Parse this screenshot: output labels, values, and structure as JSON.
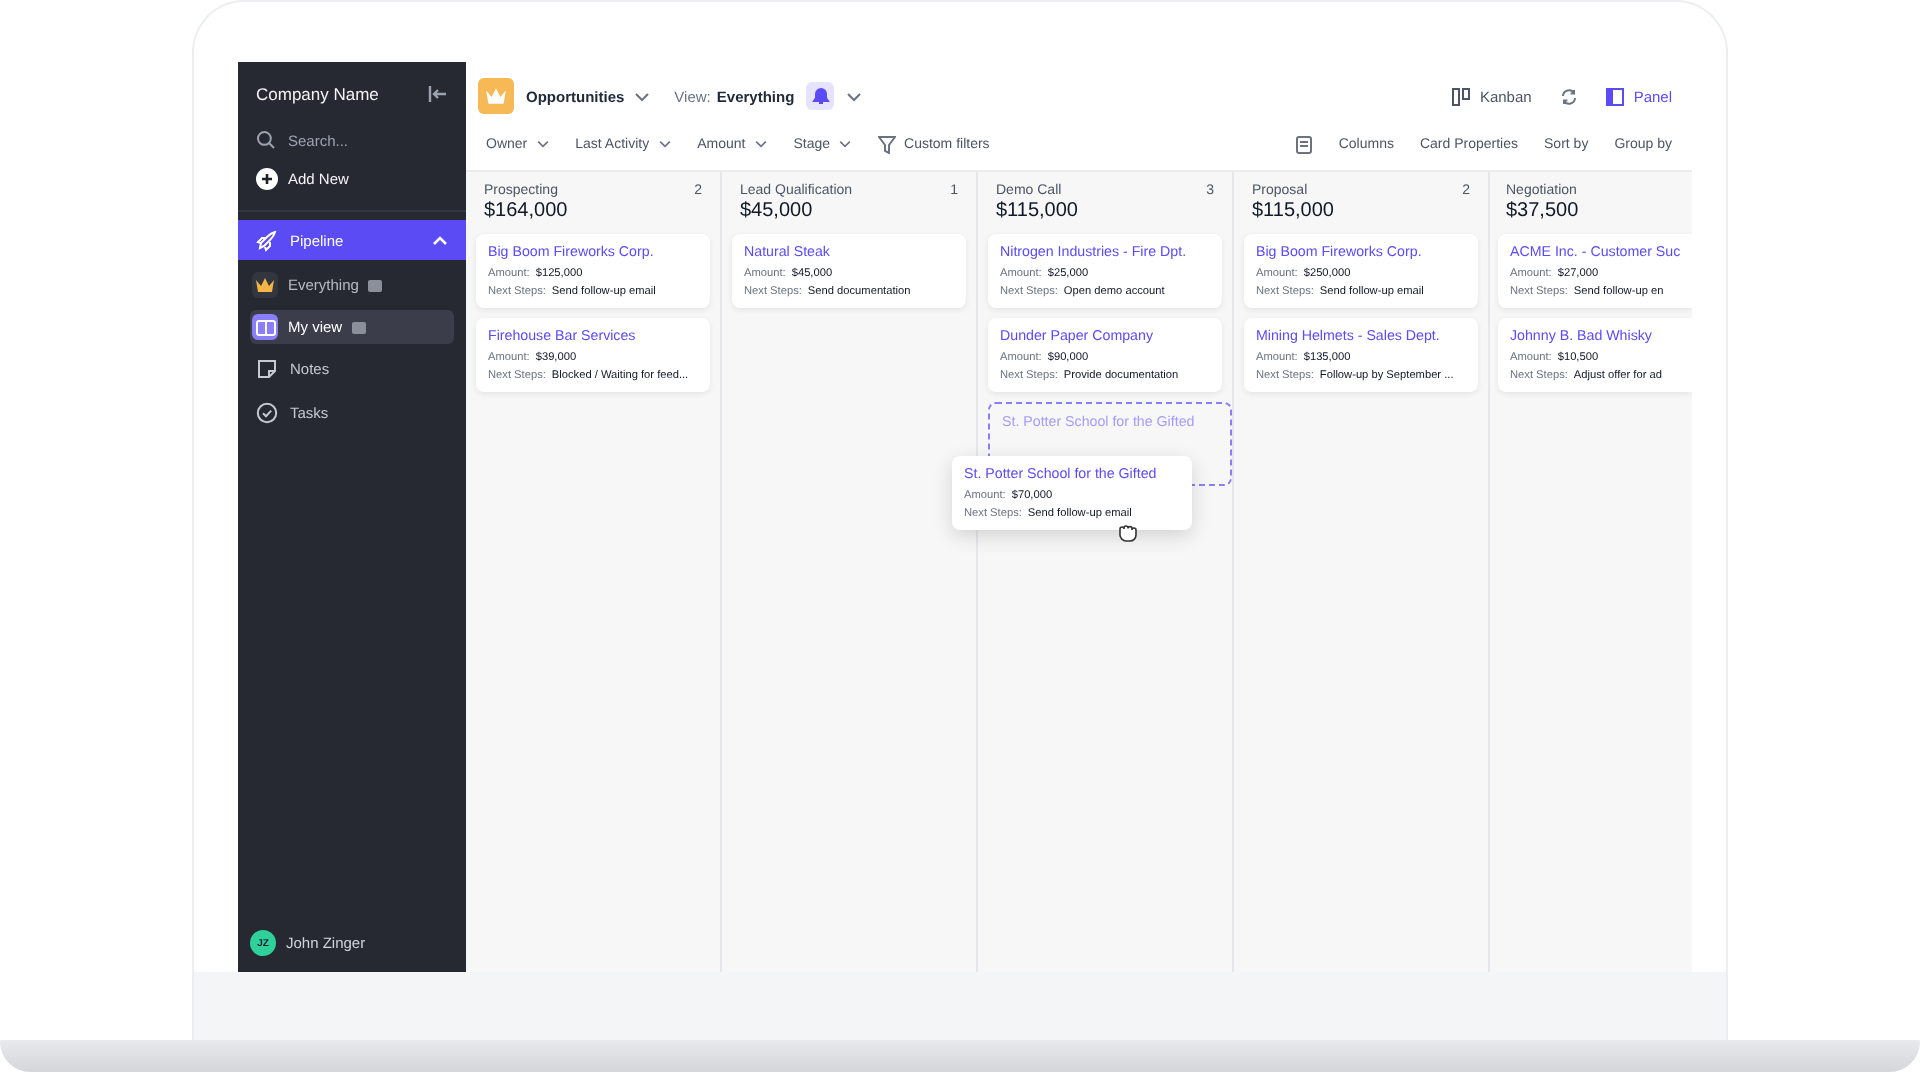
{
  "sidebar": {
    "company_name": "Company Name",
    "search": {
      "placeholder": "Search..."
    },
    "add_new": "Add New",
    "nav": [
      {
        "label": "Pipeline",
        "kind": "rocket",
        "selected": true,
        "expanded": true,
        "children": [
          {
            "label": "Everything",
            "kind": "crown",
            "selected": false
          },
          {
            "label": "My view",
            "kind": "view",
            "selected": true
          }
        ]
      },
      {
        "label": "Notes",
        "kind": "note",
        "selected": false,
        "expanded": false
      },
      {
        "label": "Tasks",
        "kind": "check",
        "selected": false,
        "expanded": false
      }
    ],
    "user": {
      "initials": "JZ",
      "name": "John Zinger"
    }
  },
  "header": {
    "object": "Opportunities",
    "view_label": "View:",
    "view_value": "Everything",
    "modes": [
      {
        "label": "Kanban",
        "kind": "kanban",
        "selected": false
      },
      {
        "label": "Panel",
        "kind": "panel",
        "selected": true
      }
    ]
  },
  "filters": [
    "Owner",
    "Last Activity",
    "Amount",
    "Stage"
  ],
  "custom_filters": "Custom filters",
  "tools": [
    "Columns",
    "Card Properties",
    "Sort by",
    "Group by"
  ],
  "columns": [
    {
      "name": "Prospecting",
      "count": "2",
      "total": "$164,000",
      "cards": [
        {
          "kind": "card",
          "title": "Big Boom Fireworks Corp.",
          "amount_label": "Amount:",
          "amount": "$125,000",
          "next_steps_label": "Next Steps:",
          "next_steps": "Send follow-up email"
        },
        {
          "kind": "card",
          "title": "Firehouse Bar Services",
          "amount_label": "Amount:",
          "amount": "$39,000",
          "next_steps_label": "Next Steps:",
          "next_steps": "Blocked / Waiting for feed..."
        }
      ]
    },
    {
      "name": "Lead Qualification",
      "count": "1",
      "total": "$45,000",
      "cards": [
        {
          "kind": "card",
          "title": "Natural Steak",
          "amount_label": "Amount:",
          "amount": "$45,000",
          "next_steps_label": "Next Steps:",
          "next_steps": "Send documentation"
        }
      ]
    },
    {
      "name": "Demo Call",
      "count": "3",
      "total": "$115,000",
      "cards": [
        {
          "kind": "card",
          "title": "Nitrogen Industries - Fire Dpt.",
          "amount_label": "Amount:",
          "amount": "$25,000",
          "next_steps_label": "Next Steps:",
          "next_steps": "Open demo account"
        },
        {
          "kind": "card",
          "title": "Dunder Paper Company",
          "amount_label": "Amount:",
          "amount": "$90,000",
          "next_steps_label": "Next Steps:",
          "next_steps": "Provide documentation"
        },
        {
          "kind": "placeholder",
          "title": "St. Potter School for the Gifted"
        }
      ]
    },
    {
      "name": "Proposal",
      "count": "2",
      "total": "$115,000",
      "cards": [
        {
          "kind": "card",
          "title": "Big Boom Fireworks Corp.",
          "amount_label": "Amount:",
          "amount": "$250,000",
          "next_steps_label": "Next Steps:",
          "next_steps": "Send follow-up email"
        },
        {
          "kind": "card",
          "title": "Mining Helmets - Sales Dept.",
          "amount_label": "Amount:",
          "amount": "$135,000",
          "next_steps_label": "Next Steps:",
          "next_steps": "Follow-up by September ..."
        }
      ]
    },
    {
      "name": "Negotiation",
      "total": "$37,500",
      "cards": [
        {
          "kind": "card",
          "title": "ACME Inc. - Customer Suc",
          "amount_label": "Amount:",
          "amount": "$27,000",
          "next_steps_label": "Next Steps:",
          "next_steps": "Send follow-up en"
        },
        {
          "kind": "card",
          "title": "Johnny B. Bad Whisky",
          "amount_label": "Amount:",
          "amount": "$10,500",
          "next_steps_label": "Next Steps:",
          "next_steps": "Adjust offer for ad"
        }
      ]
    }
  ],
  "dragged_card": {
    "title": "St. Potter School for the Gifted",
    "amount_label": "Amount:",
    "amount": "$70,000",
    "next_steps_label": "Next Steps:",
    "next_steps": "Send follow-up email"
  }
}
